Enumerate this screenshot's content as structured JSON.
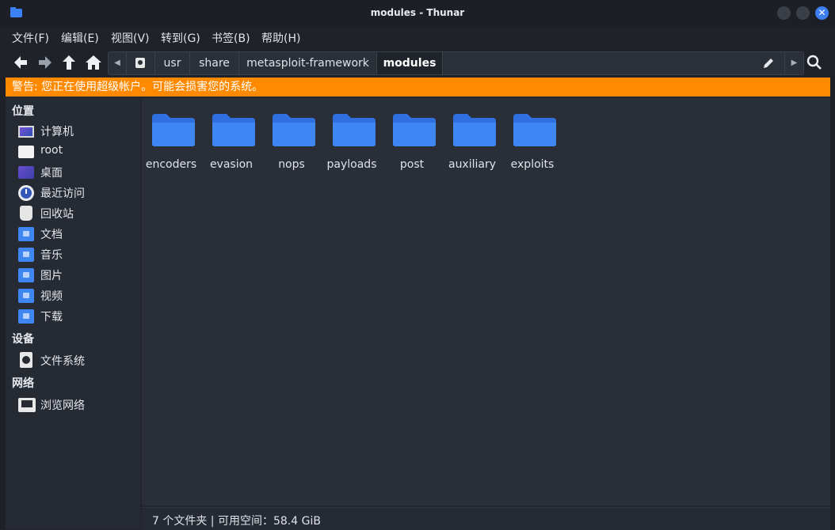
{
  "window": {
    "title": "modules - Thunar"
  },
  "menu": [
    "文件(F)",
    "编辑(E)",
    "视图(V)",
    "转到(G)",
    "书签(B)",
    "帮助(H)"
  ],
  "pathbar": {
    "segments": [
      "usr",
      "share",
      "metasploit-framework",
      "modules"
    ]
  },
  "warning": "警告: 您正在使用超级帐户。可能会损害您的系统。",
  "sidebar": {
    "places_title": "位置",
    "places": [
      {
        "label": "计算机",
        "icon": "computer-icon"
      },
      {
        "label": "root",
        "icon": "home-folder-icon"
      },
      {
        "label": "桌面",
        "icon": "desktop-icon"
      },
      {
        "label": "最近访问",
        "icon": "recent-icon"
      },
      {
        "label": "回收站",
        "icon": "trash-icon"
      },
      {
        "label": "文档",
        "icon": "documents-folder-icon"
      },
      {
        "label": "音乐",
        "icon": "music-folder-icon"
      },
      {
        "label": "图片",
        "icon": "pictures-folder-icon"
      },
      {
        "label": "视频",
        "icon": "videos-folder-icon"
      },
      {
        "label": "下载",
        "icon": "downloads-folder-icon"
      }
    ],
    "devices_title": "设备",
    "devices": [
      {
        "label": "文件系统",
        "icon": "drive-icon"
      }
    ],
    "network_title": "网络",
    "network": [
      {
        "label": "浏览网络",
        "icon": "network-icon"
      }
    ]
  },
  "files": [
    "encoders",
    "evasion",
    "nops",
    "payloads",
    "post",
    "auxiliary",
    "exploits"
  ],
  "status": "7 个文件夹 | 可用空间：58.4 GiB",
  "colors": {
    "accent": "#3d7ef0",
    "warning": "#ff8a00",
    "folder": "#3b82f6"
  }
}
